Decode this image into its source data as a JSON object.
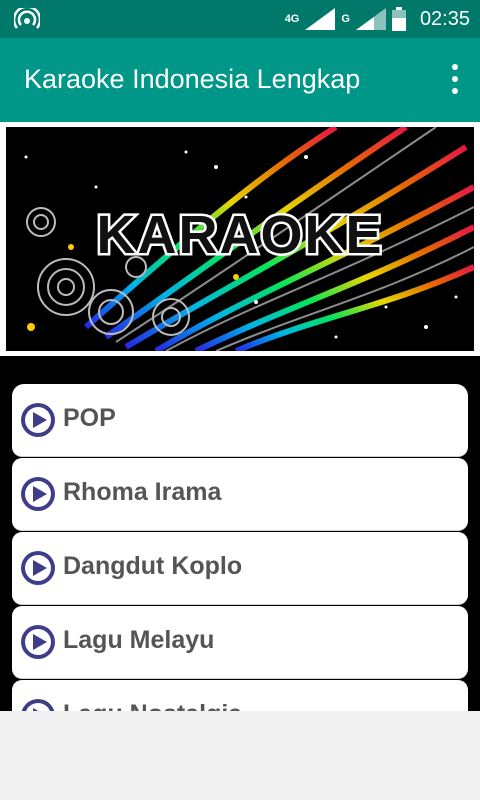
{
  "status_bar": {
    "network_1": "4G",
    "network_2": "G",
    "time": "02:35"
  },
  "app_bar": {
    "title": "Karaoke Indonesia Lengkap"
  },
  "banner": {
    "text": "KARAOKE"
  },
  "categories": [
    {
      "label": "POP"
    },
    {
      "label": "Rhoma Irama"
    },
    {
      "label": "Dangdut Koplo"
    },
    {
      "label": "Lagu Melayu"
    },
    {
      "label": "Lagu Nostalgia"
    }
  ],
  "colors": {
    "status_bar": "#00796b",
    "app_bar": "#009688",
    "play_icon": "#3f3d8a",
    "item_text": "#555555"
  }
}
